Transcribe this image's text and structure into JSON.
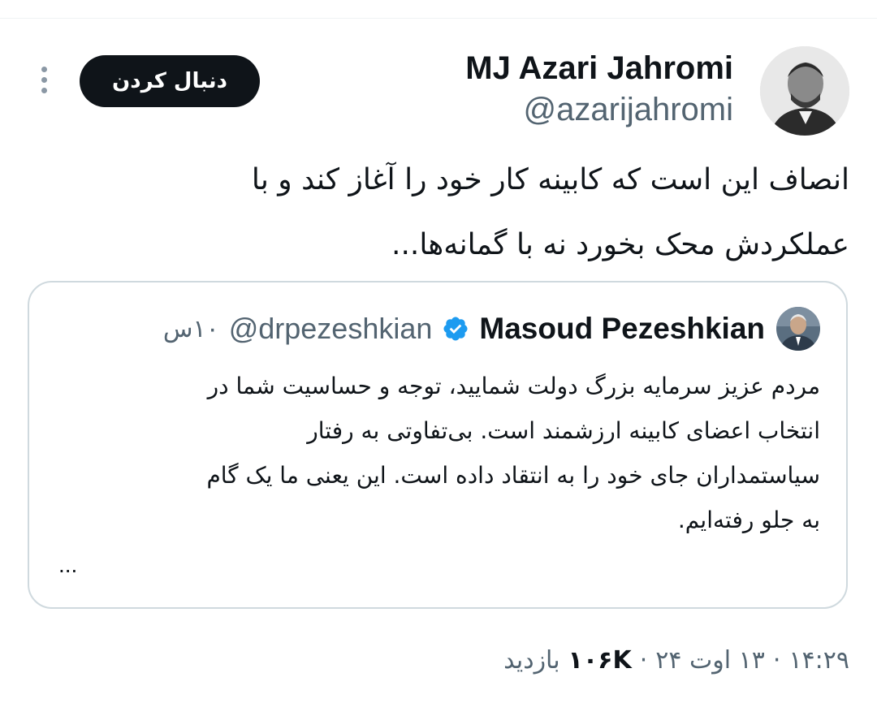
{
  "author": {
    "display_name": "MJ Azari Jahromi",
    "handle": "@azarijahromi",
    "follow_label": "دنبال کردن"
  },
  "tweet": {
    "lines": [
      "انصاف این است که کابینه کار خود را آغاز کند و با",
      "عملکردش محک بخورد نه با گمانه‌ها..."
    ]
  },
  "quote": {
    "display_name": "Masoud Pezeshkian",
    "handle": "@drpezeshkian",
    "time": "۱۰س",
    "lines": [
      "مردم عزیز سرمایه بزرگ دولت شمایید، توجه و حساسیت شما در",
      "انتخاب اعضای کابینه ارزشمند است. بی‌تفاوتی به رفتار",
      "سیاستمداران جای خود را به انتقاد داده است. این یعنی ما یک گام",
      "به جلو رفته‌ایم."
    ],
    "ellipsis": "..."
  },
  "meta": {
    "time": "۱۴:۲۹",
    "separator": "·",
    "date": "۱۳ اوت ۲۴",
    "views_count": "۱۰۶K",
    "views_label": "بازدید"
  },
  "icons": {
    "more": "more-vertical-icon",
    "verified": "verified-badge-icon"
  },
  "colors": {
    "text": "#0f1419",
    "secondary": "#536471",
    "border": "#cfd9de",
    "verified": "#1d9bf0",
    "button_bg": "#0f1419"
  }
}
